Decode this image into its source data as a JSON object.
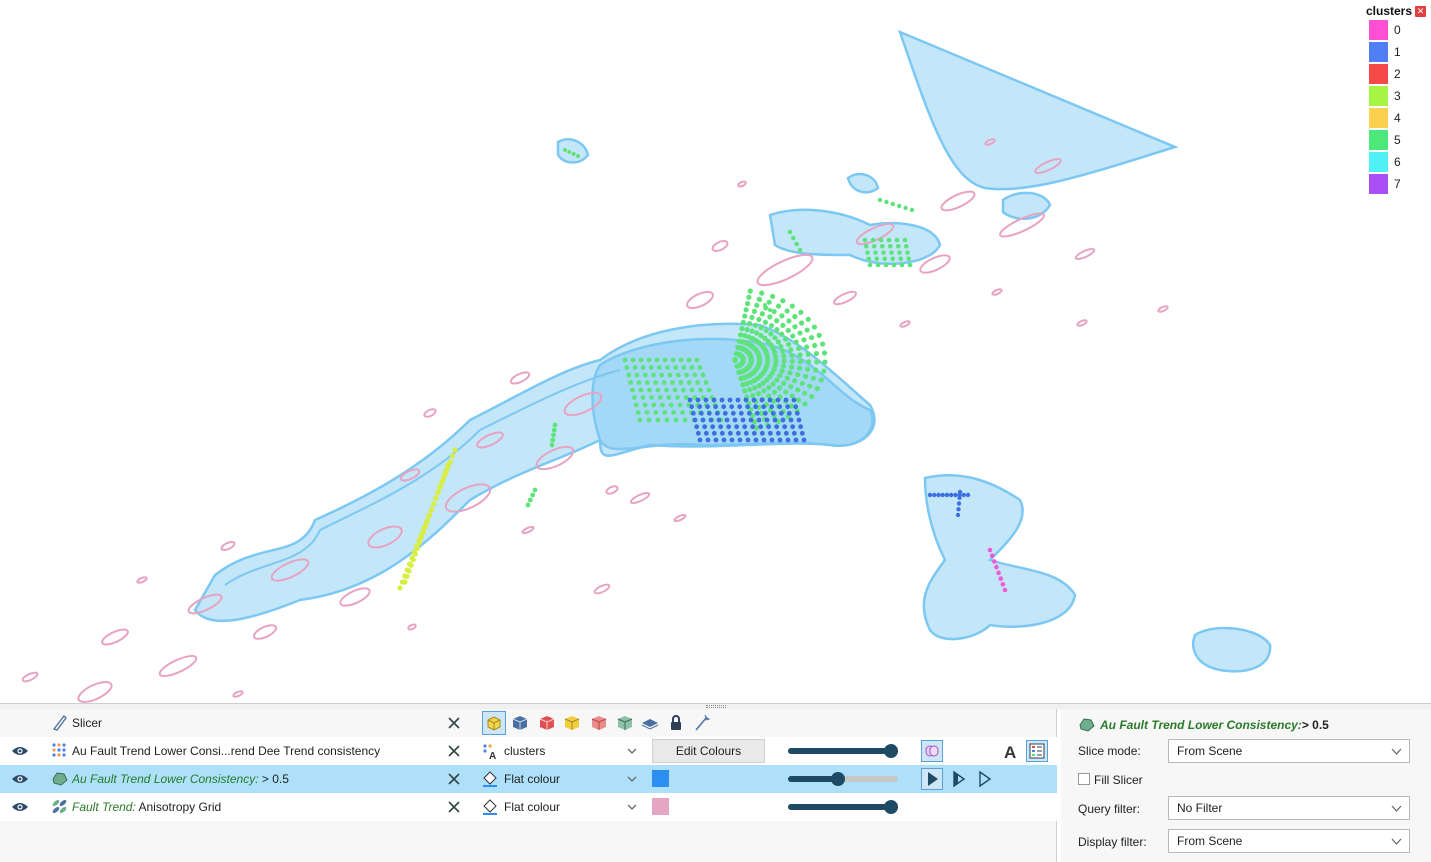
{
  "legend": {
    "title": "clusters",
    "close_icon": "close-icon",
    "entries": [
      {
        "label": "0",
        "color": "#ff4fd2"
      },
      {
        "label": "1",
        "color": "#4f7ef5"
      },
      {
        "label": "2",
        "color": "#f54a4a"
      },
      {
        "label": "3",
        "color": "#a6f545"
      },
      {
        "label": "4",
        "color": "#fbcf4f"
      },
      {
        "label": "5",
        "color": "#4de87a"
      },
      {
        "label": "6",
        "color": "#4ff1f5"
      },
      {
        "label": "7",
        "color": "#a84ff5"
      }
    ]
  },
  "scene": {
    "mesh_color": "#7cc8f2",
    "ellipse_color": "#e8a3c2",
    "points_green": "#5ee37a",
    "points_blue": "#3e6fe0",
    "points_yellow": "#d8ee45",
    "points_magenta": "#f05ad8"
  },
  "objects": {
    "rows": [
      {
        "name": "Slicer",
        "prefix": "",
        "suffix": "",
        "has_eye": false,
        "icon": "slicer-icon"
      },
      {
        "name": "Au Fault Trend Lower Consi...rend Dee Trend consistency",
        "prefix": "",
        "suffix": "",
        "has_eye": true,
        "icon": "points-icon",
        "property": "clusters",
        "edit_label": "Edit Colours"
      },
      {
        "name": "",
        "prefix": "Au Fault Trend Lower Consistency:",
        "suffix": " > 0.5",
        "has_eye": true,
        "icon": "surface-icon",
        "property": "Flat colour",
        "color": "#2b8ef0",
        "selected": true
      },
      {
        "name": "",
        "prefix": "Fault Trend:",
        "suffix": " Anisotropy Grid",
        "has_eye": true,
        "icon": "grid-icon",
        "property": "Flat colour",
        "color": "#e4a6c0"
      }
    ],
    "opacity": {
      "clusters": 1.0,
      "surface": 0.45,
      "grid": 1.0
    }
  },
  "props": {
    "title_prefix": "Au Fault Trend Lower Consistency:",
    "title_suffix": " > 0.5",
    "slice_mode_label": "Slice mode:",
    "slice_mode_value": "From Scene",
    "fill_slicer_label": "Fill Slicer",
    "query_filter_label": "Query filter:",
    "query_filter_value": "No Filter",
    "display_filter_label": "Display filter:",
    "display_filter_value": "From Scene"
  }
}
